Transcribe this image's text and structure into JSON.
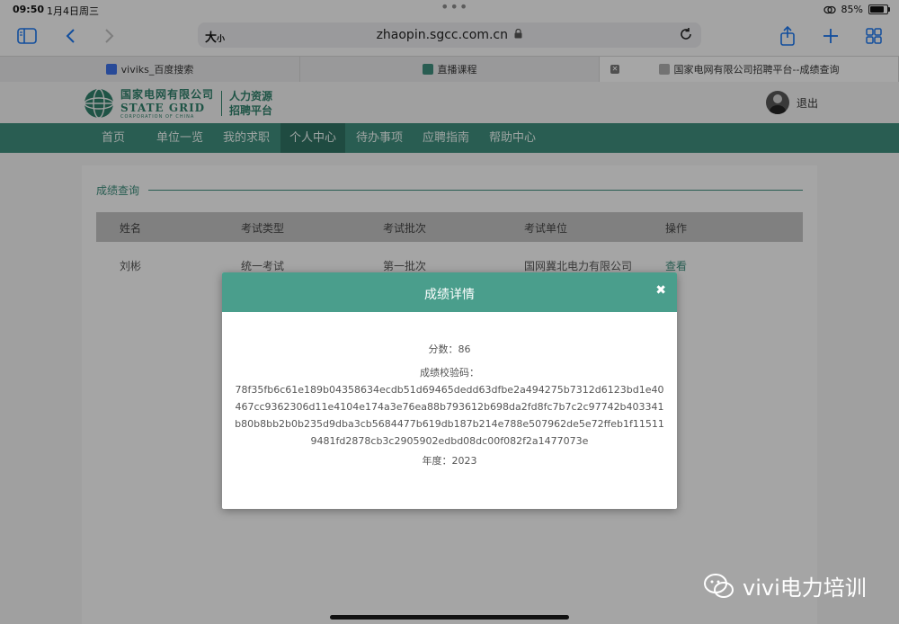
{
  "status_bar": {
    "time": "09:50",
    "date": "1月4日周三",
    "battery": "85%",
    "battery_level": 0.85
  },
  "browser": {
    "text_size_big": "大",
    "text_size_small": "小",
    "url": "zhaopin.sgcc.com.cn",
    "tabs": [
      {
        "label": "viviks_百度搜索"
      },
      {
        "label": "直播课程"
      },
      {
        "label": "国家电网有限公司招聘平台--成绩查询"
      }
    ]
  },
  "site": {
    "logo_cn": "国家电网有限公司",
    "logo_en": "STATE GRID",
    "logo_en_sub": "CORPORATION OF CHINA",
    "logo_hr_1": "人力资源",
    "logo_hr_2": "招聘平台",
    "logout": "退出",
    "nav": [
      {
        "label": "首页"
      },
      {
        "label": "单位一览"
      },
      {
        "label": "我的求职"
      },
      {
        "label": "个人中心"
      },
      {
        "label": "待办事项"
      },
      {
        "label": "应聘指南"
      },
      {
        "label": "帮助中心"
      }
    ],
    "active_nav": "个人中心"
  },
  "results": {
    "section_title": "成绩查询",
    "columns": [
      "姓名",
      "考试类型",
      "考试批次",
      "考试单位",
      "操作"
    ],
    "rows": [
      {
        "name": "刘彬",
        "type": "统一考试",
        "batch": "第一批次",
        "unit": "国网冀北电力有限公司",
        "action": "查看"
      }
    ]
  },
  "modal": {
    "title": "成绩详情",
    "close": "✖",
    "score": "分数：86",
    "code_label": "成绩校验码：",
    "code": "78f35fb6c61e189b04358634ecdb51d69465dedd63dfbe2a494275b7312d6123bd1e40467cc9362306d11e4104e174a3e76ea88b793612b698da2fd8fc7b7c2c97742b403341b80b8bb2b0b235d9dba3cb5684477b619db187b214e788e507962de5e72ffeb1f115119481fd2878cb3c2905902edbd08dc00f082f2a1477073e",
    "year": "年度：2023"
  },
  "watermark": "vivi电力培训"
}
